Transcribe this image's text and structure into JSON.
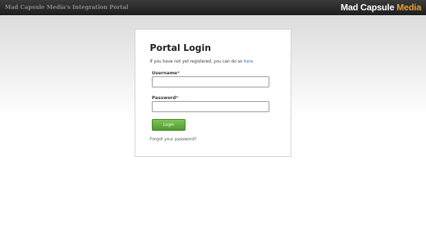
{
  "header": {
    "portal_title": "Mad Capsule Media's Integration Portal",
    "brand_primary": "Mad Capsule",
    "brand_accent": "Media",
    "brand_accent_color": "#e8a02a"
  },
  "login": {
    "title": "Portal Login",
    "register_prefix": "If you have not yet registered, you can do so",
    "register_link": "here",
    "register_suffix": ".",
    "username_label": "Username",
    "password_label": "Password",
    "required_marker": "*",
    "username_value": "",
    "password_value": "",
    "login_button": "Login",
    "login_button_color": "#5ca838",
    "forgot_link": "Forgot your password?"
  }
}
